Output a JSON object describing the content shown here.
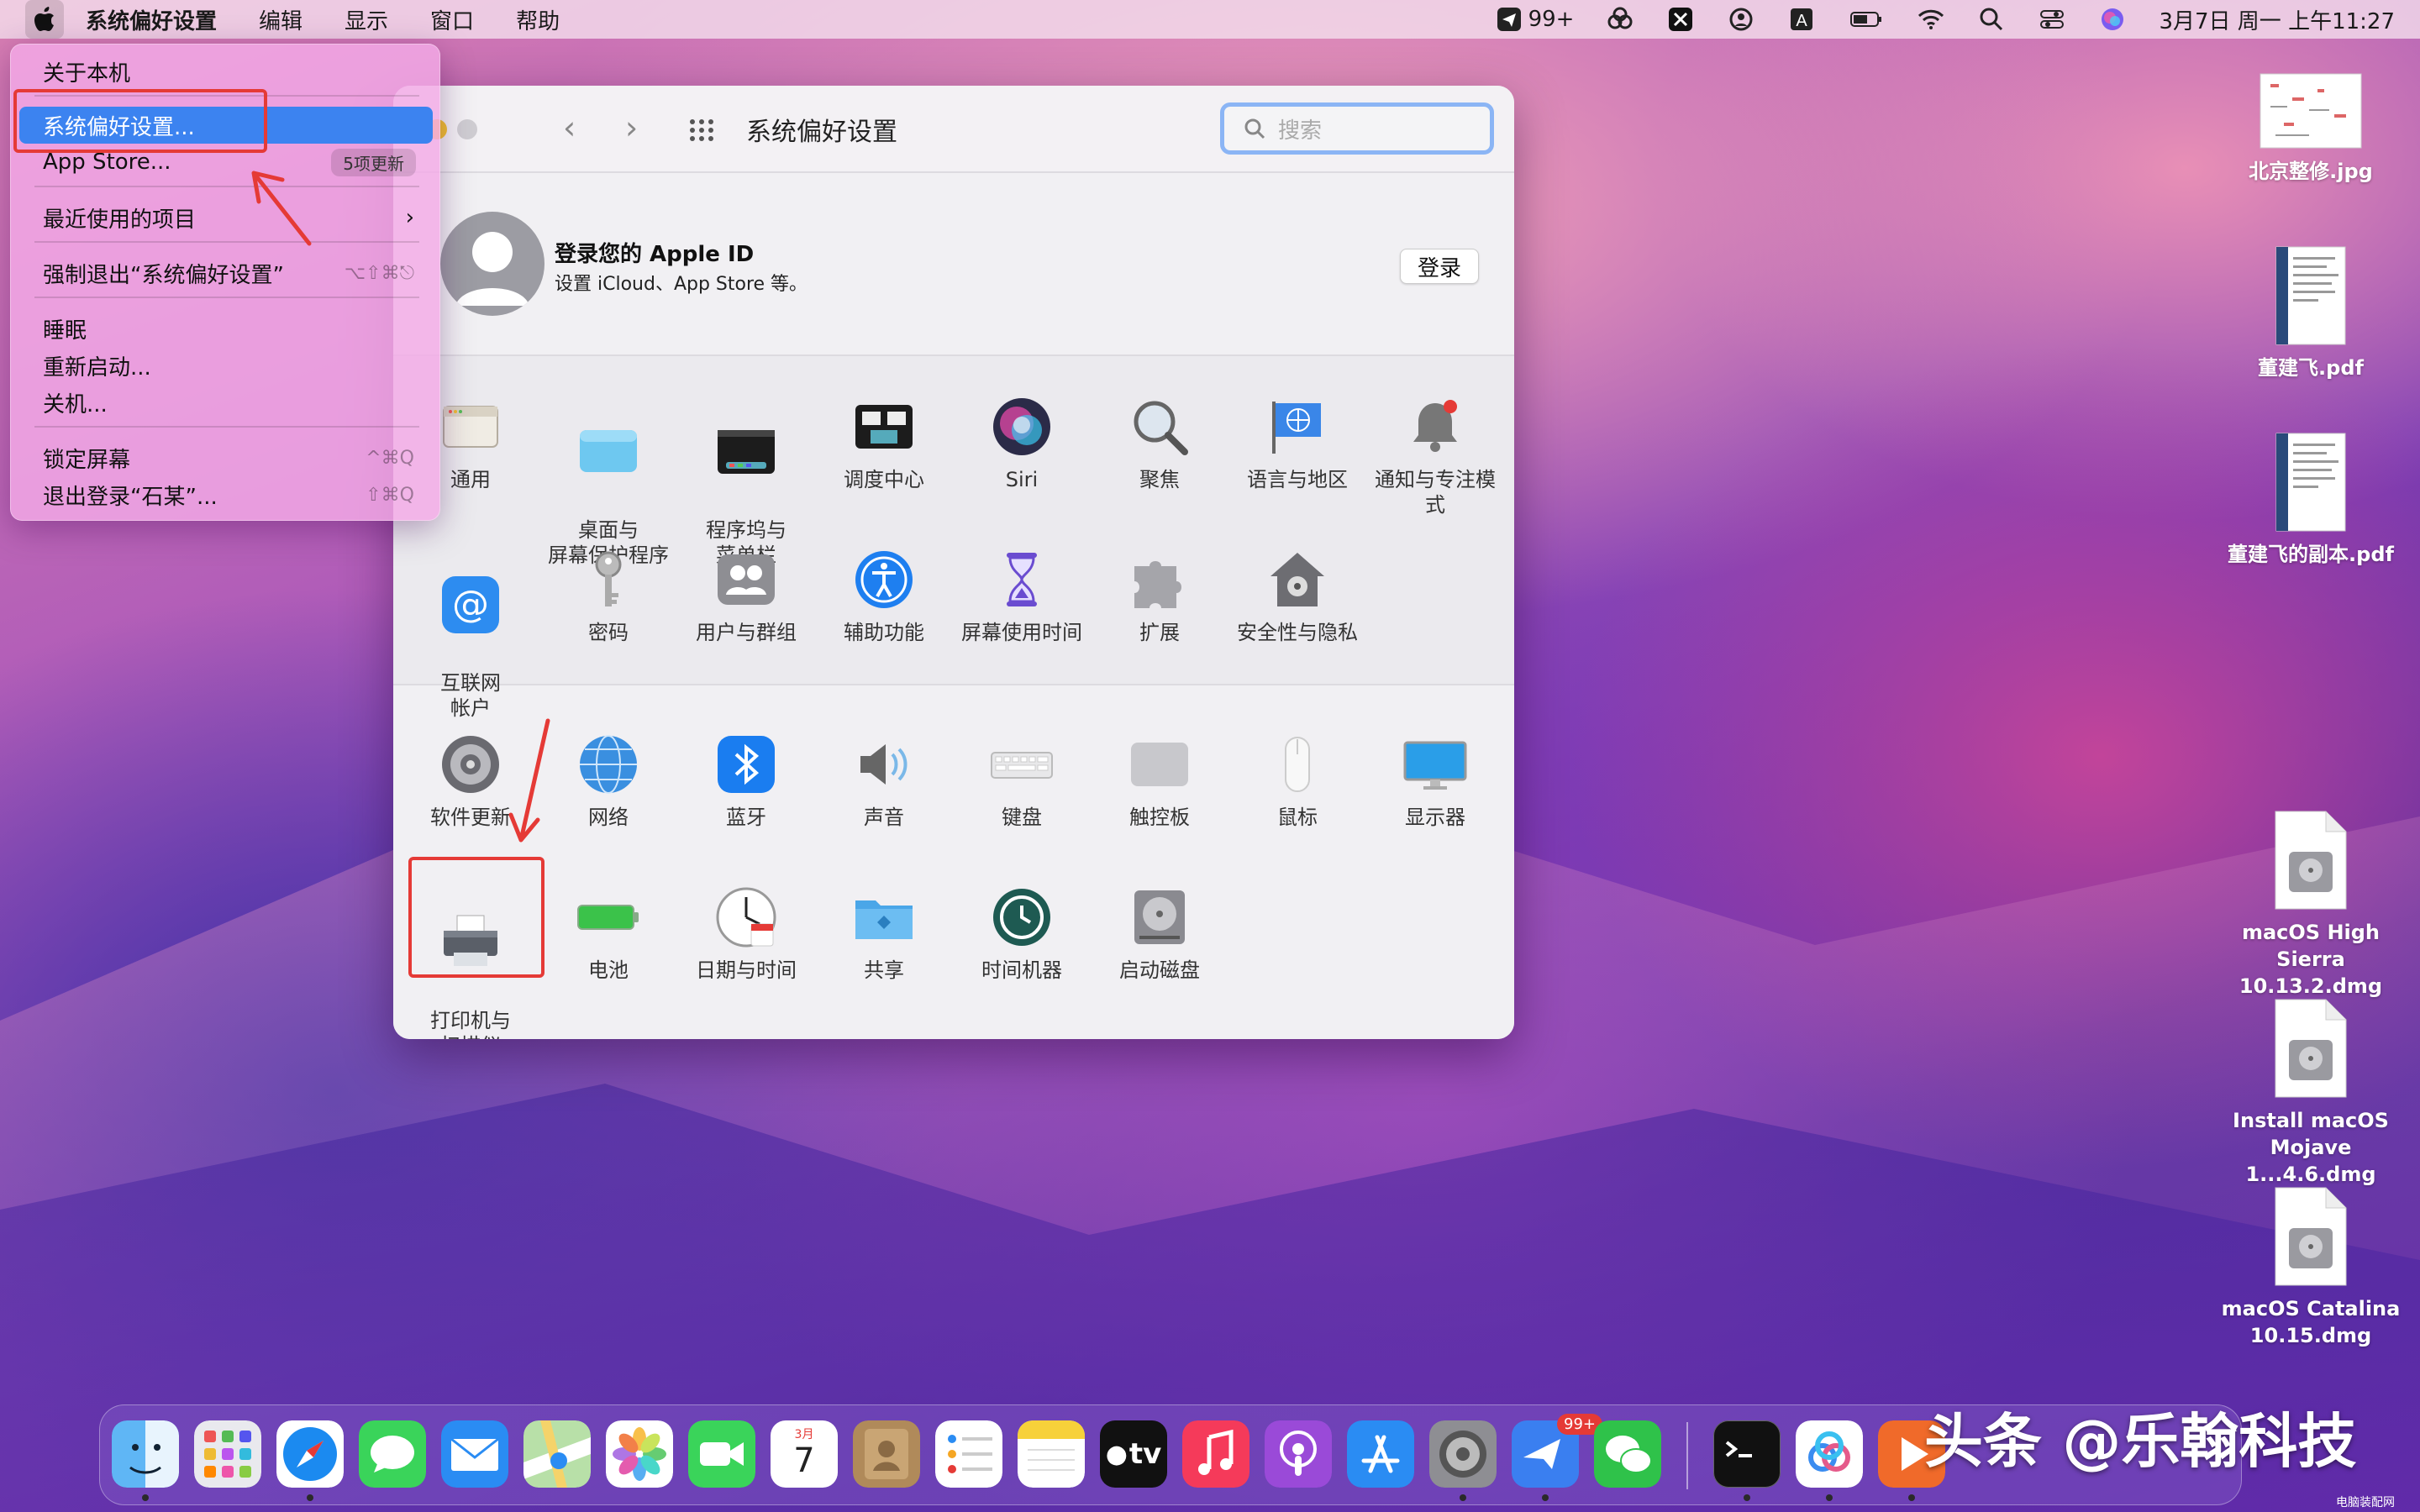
{
  "menubar": {
    "app_name": "系统偏好设置",
    "items": [
      "编辑",
      "显示",
      "窗口",
      "帮助"
    ],
    "status_badge": "99+",
    "clock": "3月7日 周一 上午11:27"
  },
  "apple_menu": {
    "about": "关于本机",
    "system_prefs": "系统偏好设置...",
    "app_store": "App Store...",
    "app_store_badge": "5项更新",
    "recent_items": "最近使用的项目",
    "force_quit": "强制退出“系统偏好设置”",
    "force_quit_shortcut": "⌥⇧⌘⎋",
    "sleep": "睡眠",
    "restart": "重新启动...",
    "shutdown": "关机...",
    "lock_screen": "锁定屏幕",
    "lock_shortcut": "^⌘Q",
    "logout": "退出登录“石某”...",
    "logout_shortcut": "⇧⌘Q"
  },
  "window": {
    "title": "系统偏好设置",
    "search_placeholder": "搜索",
    "apple_id_title": "登录您的 Apple ID",
    "apple_id_sub": "设置 iCloud、App Store 等。",
    "login_button": "登录",
    "panes_row1": [
      "通用",
      "桌面与\n屏幕保护程序",
      "程序坞与\n菜单栏",
      "调度中心",
      "Siri",
      "聚焦",
      "语言与地区",
      "通知与专注模式"
    ],
    "panes_row2": [
      "互联网\n帐户",
      "密码",
      "用户与群组",
      "辅助功能",
      "屏幕使用时间",
      "扩展",
      "安全性与隐私"
    ],
    "panes_row3": [
      "软件更新",
      "网络",
      "蓝牙",
      "声音",
      "键盘",
      "触控板",
      "鼠标",
      "显示器"
    ],
    "panes_row4": [
      "打印机与\n扫描仪",
      "电池",
      "日期与时间",
      "共享",
      "时间机器",
      "启动磁盘"
    ]
  },
  "desktop_files": [
    "北京整修.jpg",
    "董建飞.pdf",
    "董建飞的副本.pdf",
    "macOS High Sierra 10.13.2.dmg",
    "Install macOS Mojave 1...4.6.dmg",
    "macOS Catalina 10.15.dmg"
  ],
  "dock": {
    "calendar_month": "3月",
    "calendar_day": "7",
    "tv_label": "tv",
    "badge": "99+"
  },
  "watermark": "头条 @乐翰科技",
  "watermark_small": "电脑装配网"
}
